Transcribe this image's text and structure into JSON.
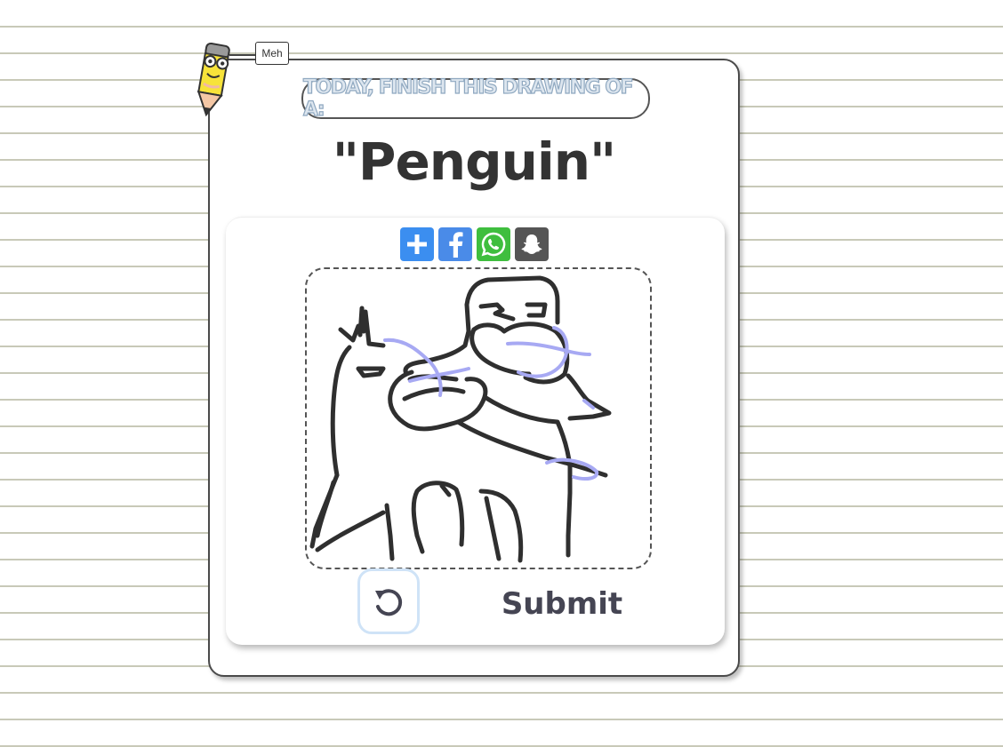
{
  "mascot": {
    "mood_label": "Meh",
    "icon": "pencil-mascot-icon"
  },
  "header": {
    "prompt_text": "TODAY, FINISH THIS DRAWING OF A:",
    "word": "\"Penguin\""
  },
  "share": {
    "buttons": [
      {
        "icon": "plus-icon",
        "color": "#3b8ef0"
      },
      {
        "icon": "facebook-icon",
        "color": "#4a8be8"
      },
      {
        "icon": "whatsapp-icon",
        "color": "#3fbe3e"
      },
      {
        "icon": "snapchat-icon",
        "color": "#555555"
      }
    ]
  },
  "canvas": {
    "ink_color": "#2f2f2f",
    "overlay_color": "#a7a9f3"
  },
  "actions": {
    "undo_icon": "undo-icon",
    "submit_label": "Submit"
  },
  "theme": {
    "paper_line_color": "#c8c9b8",
    "undo_border_color": "#cfe3f7"
  }
}
